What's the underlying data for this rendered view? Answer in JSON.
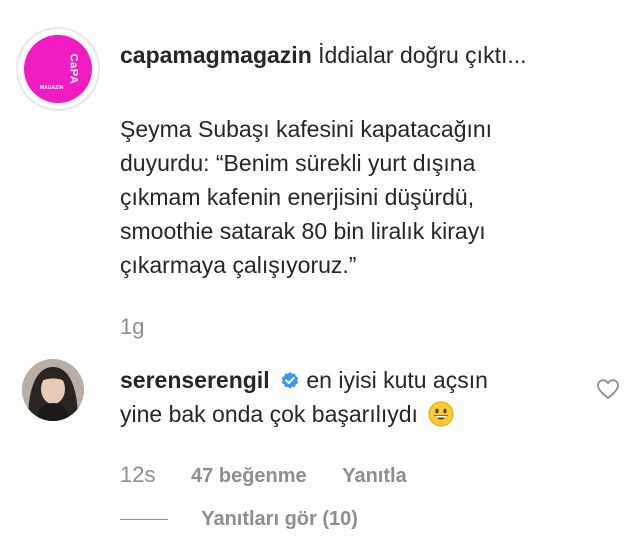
{
  "post": {
    "username": "capamagmagazin",
    "headline": "İddialar doğru çıktı...",
    "avatar_logo": "CaPA",
    "avatar_tag": "MAGAZİN",
    "body_lines": [
      "Şeyma Subaşı kafesini kapatacağını",
      "duyurdu: “Benim sürekli yurt dışına",
      "çıkmam kafenin enerjisini düşürdü,",
      "smoothie satarak 80 bin liralık kirayı",
      "çıkarmaya çalışıyoruz.”"
    ],
    "age": "1g"
  },
  "comment": {
    "username": "serenserengil",
    "text_line1": "en iyisi kutu açsın",
    "text_line2": "yine bak onda çok başarılıydı",
    "age": "12s",
    "likes": "47 beğenme",
    "reply": "Yanıtla",
    "view_replies": "Yanıtları gör (10)"
  },
  "icons": {
    "verified": "verified-badge-icon",
    "emoji": "grinning-face-emoji",
    "like": "heart-outline-icon"
  },
  "colors": {
    "text": "#262626",
    "muted": "#8e8e8e",
    "verified": "#3897f0",
    "avatar_pink": "#f11bc4"
  }
}
